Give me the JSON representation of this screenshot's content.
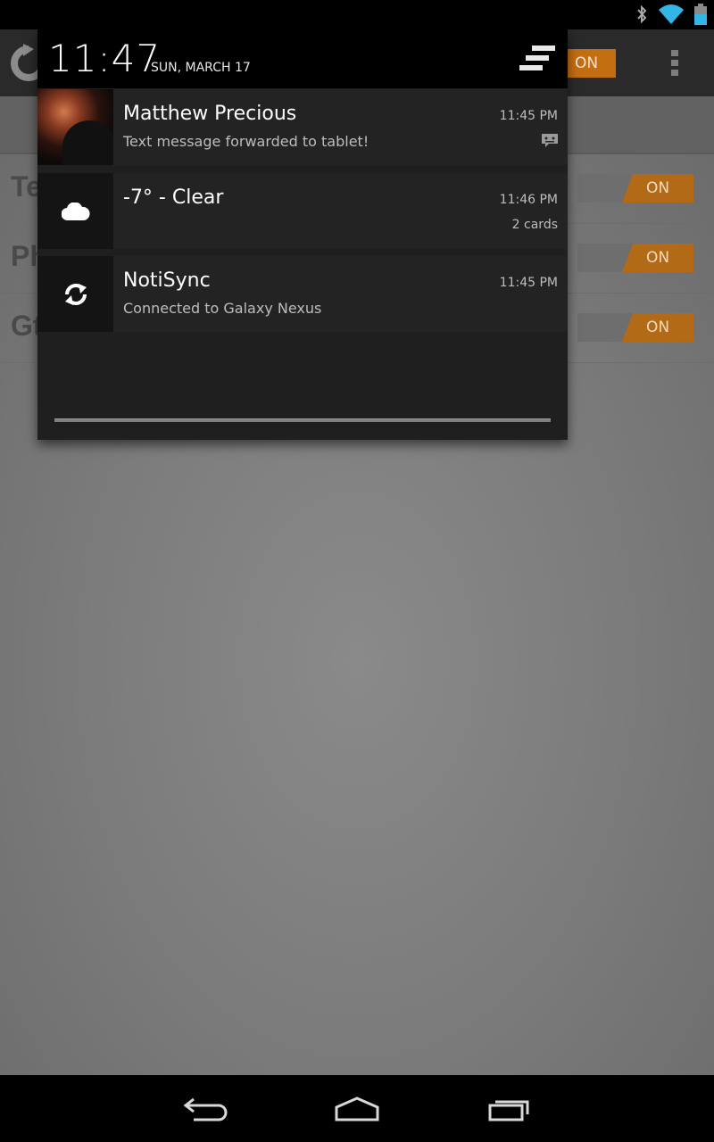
{
  "status_bar": {
    "icons": [
      "bluetooth-icon",
      "wifi-icon",
      "battery-icon"
    ],
    "accent": "#33b5e5"
  },
  "app": {
    "header_toggle_label": "ON",
    "rows": [
      {
        "label": "Te",
        "toggle": "ON"
      },
      {
        "label": "Phone calls",
        "toggle": "ON"
      },
      {
        "label": "Gtalk",
        "toggle": "ON"
      }
    ],
    "accent": "#c46e12"
  },
  "shade": {
    "time": "11:47",
    "date": "SUN, MARCH 17",
    "clear_all_icon": "clear-all-icon",
    "notifications": [
      {
        "icon": "contact-photo",
        "title": "Matthew Precious",
        "text": "Text message forwarded to tablet!",
        "time": "11:45 PM",
        "small_icon": "sms-icon"
      },
      {
        "icon": "cloud-icon",
        "title": "-7° - Clear",
        "time": "11:46 PM",
        "info": "2 cards"
      },
      {
        "icon": "sync-icon",
        "title": "NotiSync",
        "text": "Connected to Galaxy Nexus",
        "time": "11:45 PM"
      }
    ]
  },
  "nav_bar": {
    "buttons": [
      "back-icon",
      "home-icon",
      "recents-icon"
    ]
  }
}
